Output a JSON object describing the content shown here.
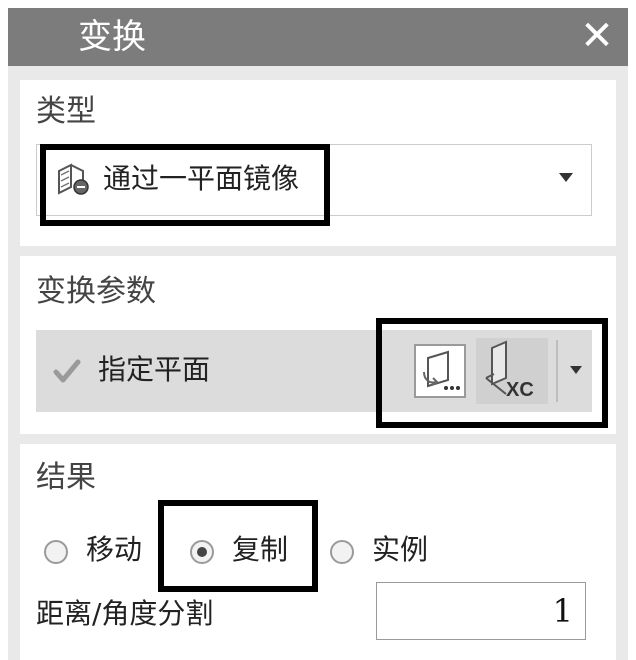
{
  "dialog": {
    "title": "变换"
  },
  "type_section": {
    "label": "类型",
    "selected": "通过一平面镜像"
  },
  "params_section": {
    "label": "变换参数",
    "plane_label": "指定平面",
    "xc_icon_text": "XC"
  },
  "result_section": {
    "label": "结果",
    "options": [
      {
        "label": "移动",
        "selected": false
      },
      {
        "label": "复制",
        "selected": true
      },
      {
        "label": "实例",
        "selected": false
      }
    ],
    "distance_label": "距离/角度分割",
    "distance_value": "1"
  },
  "icons": {
    "close": "close-icon",
    "type": "mirror-plane-icon",
    "check": "checkmark-icon",
    "plane_dialog": "plane-dialog-icon",
    "xc_plane": "xc-plane-icon",
    "dropdown": "chevron-down-icon"
  },
  "colors": {
    "titlebar": "#7c7c7c",
    "panel_bg": "#e9e9e9",
    "highlight_border": "#000000"
  }
}
